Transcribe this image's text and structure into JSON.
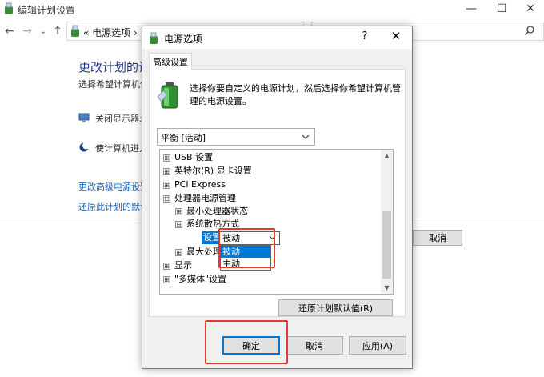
{
  "bg_window": {
    "title": "编辑计划设置",
    "controls": {
      "minimize": "—",
      "maximize": "☐",
      "close": "✕"
    },
    "nav": {
      "back": "←",
      "forward": "→",
      "dropdown": "⌄",
      "up": "↑"
    },
    "address": "« 电源选项 ›",
    "heading": "更改计划的设",
    "subtitle": "选择希望计算机使",
    "row1": "关闭显示器:",
    "row2": "使计算机进入",
    "link1": "更改高级电源设置",
    "link2": "还原此计划的默认",
    "cancel_button": "取消"
  },
  "dialog": {
    "title": "电源选项",
    "help": "?",
    "close": "✕",
    "tab": "高级设置",
    "description": "选择你要自定义的电源计划，然后选择你希望计算机管理的电源设置。",
    "plan_select": "平衡 [活动]",
    "tree": [
      {
        "expander": "⊞",
        "label": "USB 设置",
        "level": 0
      },
      {
        "expander": "⊞",
        "label": "英特尔(R) 显卡设置",
        "level": 0
      },
      {
        "expander": "⊞",
        "label": "PCI Express",
        "level": 0
      },
      {
        "expander": "⊟",
        "label": "处理器电源管理",
        "level": 0
      },
      {
        "expander": "⊞",
        "label": "最小处理器状态",
        "level": 1
      },
      {
        "expander": "⊟",
        "label": "系统散热方式",
        "level": 1
      },
      {
        "expander": "",
        "label": "",
        "level": 2
      },
      {
        "expander": "⊞",
        "label": "最大处理",
        "level": 1
      },
      {
        "expander": "⊞",
        "label": "显示",
        "level": 0
      },
      {
        "expander": "⊞",
        "label": "\"多媒体\"设置",
        "level": 0
      }
    ],
    "setting_label": "设置",
    "setting_value": "被动",
    "dropdown_options": [
      "被动",
      "主动"
    ],
    "restore_button": "还原计划默认值(R)",
    "ok_button": "确定",
    "cancel_button": "取消",
    "apply_button": "应用(A)"
  },
  "colors": {
    "accent": "#0078d7",
    "highlight_box": "#e53935",
    "link": "#1a5fb4",
    "heading": "#1e3287"
  }
}
